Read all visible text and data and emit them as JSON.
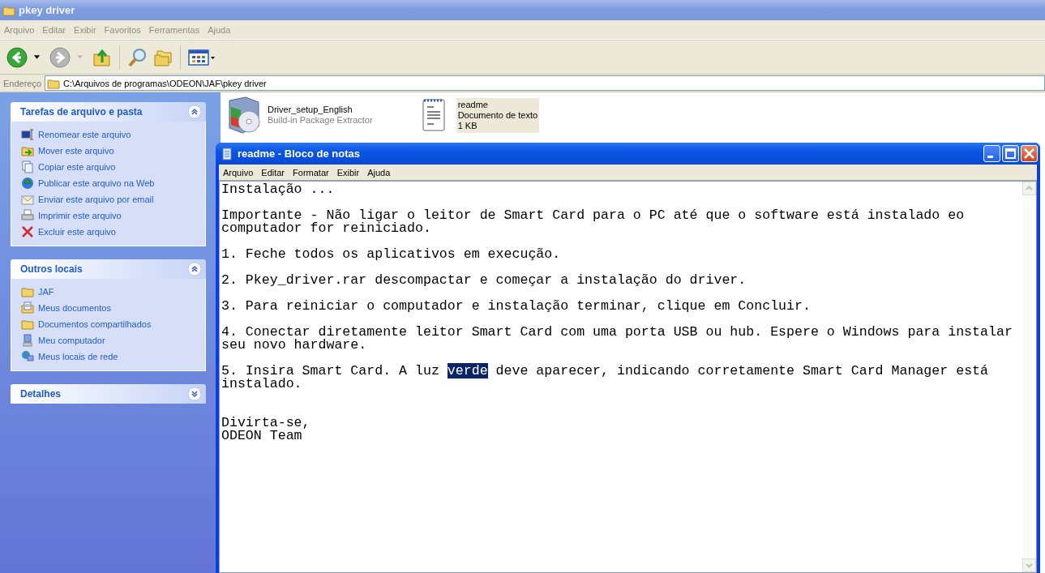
{
  "explorer": {
    "title": "pkey driver",
    "menu": [
      "Arquivo",
      "Editar",
      "Exibir",
      "Favoritos",
      "Ferramentas",
      "Ajuda"
    ],
    "toolbar": {
      "back": {
        "disabled": false
      },
      "forward": {
        "disabled": true
      }
    },
    "address": {
      "label": "Endereço",
      "value": "C:\\Arquivos de programas\\ODEON\\JAF\\pkey driver"
    },
    "panels": [
      {
        "title": "Tarefas de arquivo e pasta",
        "expanded": true,
        "items": [
          "Renomear este arquivo",
          "Mover este arquivo",
          "Copiar este arquivo",
          "Publicar este arquivo na Web",
          "Enviar este arquivo por email",
          "Imprimir este arquivo",
          "Excluir este arquivo"
        ]
      },
      {
        "title": "Outros locais",
        "expanded": true,
        "items": [
          "JAF",
          "Meus documentos",
          "Documentos compartilhados",
          "Meu computador",
          "Meus locais de rede"
        ]
      },
      {
        "title": "Detalhes",
        "expanded": false
      }
    ],
    "files": [
      {
        "name": "Driver_setup_English",
        "details": [
          "Build-in Package Extractor"
        ],
        "selected": false
      },
      {
        "name": "readme",
        "details": [
          "Documento de texto",
          "1 KB"
        ],
        "selected": true
      }
    ]
  },
  "notepad": {
    "title": "readme - Bloco de notas",
    "active": true,
    "menu": [
      "Arquivo",
      "Editar",
      "Formatar",
      "Exibir",
      "Ajuda"
    ],
    "lines": [
      {
        "kind": "text",
        "parts": [
          {
            "text": "Instalação ...",
            "selected": false
          }
        ]
      },
      {
        "kind": "blank"
      },
      {
        "kind": "text",
        "parts": [
          {
            "text": "Importante - Não ligar o leitor de Smart Card para o PC até que o software está instalado eo",
            "selected": false
          }
        ]
      },
      {
        "kind": "text",
        "parts": [
          {
            "text": "computador for reiniciado.",
            "selected": false
          }
        ]
      },
      {
        "kind": "blank"
      },
      {
        "kind": "text",
        "parts": [
          {
            "text": "1. Feche todos os aplicativos em execução.",
            "selected": false
          }
        ]
      },
      {
        "kind": "blank"
      },
      {
        "kind": "text",
        "parts": [
          {
            "text": "2. Pkey_driver.rar descompactar e começar a instalação do driver.",
            "selected": false
          }
        ]
      },
      {
        "kind": "blank"
      },
      {
        "kind": "text",
        "parts": [
          {
            "text": "3. Para reiniciar o computador e instalação terminar, clique em Concluir.",
            "selected": false
          }
        ]
      },
      {
        "kind": "blank"
      },
      {
        "kind": "text",
        "parts": [
          {
            "text": "4. Conectar diretamente leitor Smart Card com uma porta USB ou hub. Espere o Windows para instalar",
            "selected": false
          }
        ]
      },
      {
        "kind": "text",
        "parts": [
          {
            "text": "seu novo hardware.",
            "selected": false
          }
        ]
      },
      {
        "kind": "blank"
      },
      {
        "kind": "text",
        "parts": [
          {
            "text": "5. Insira Smart Card. A luz ",
            "selected": false
          },
          {
            "text": "verde",
            "selected": true
          },
          {
            "text": " deve aparecer, indicando corretamente Smart Card Manager está",
            "selected": false
          }
        ]
      },
      {
        "kind": "text",
        "parts": [
          {
            "text": "instalado.",
            "selected": false
          }
        ]
      },
      {
        "kind": "blank"
      },
      {
        "kind": "blank"
      },
      {
        "kind": "text",
        "parts": [
          {
            "text": "Divirta-se,",
            "selected": false
          }
        ]
      },
      {
        "kind": "text",
        "parts": [
          {
            "text": "ODEON Team",
            "selected": false
          }
        ]
      }
    ]
  }
}
